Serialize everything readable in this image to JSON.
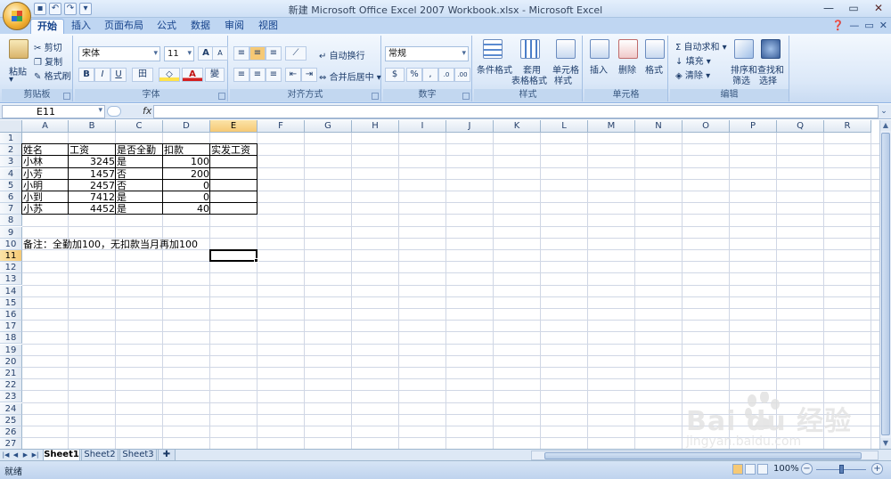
{
  "app": {
    "title": "新建 Microsoft Office Excel 2007 Workbook.xlsx - Microsoft Excel"
  },
  "window_controls": {
    "min": "—",
    "max": "▭",
    "close": "✕"
  },
  "tabs": [
    "开始",
    "插入",
    "页面布局",
    "公式",
    "数据",
    "审阅",
    "视图"
  ],
  "ribbon": {
    "clipboard": {
      "paste": "粘贴",
      "cut": "剪切",
      "copy": "复制",
      "format_painter": "格式刷",
      "label": "剪贴板"
    },
    "font": {
      "font_name": "宋体",
      "font_size": "11",
      "grow": "A",
      "shrink": "A",
      "bold": "B",
      "italic": "I",
      "underline": "U",
      "border": "田",
      "fill": "◇",
      "color": "A",
      "phonetic": "變",
      "label": "字体"
    },
    "alignment": {
      "wrap": "自动换行",
      "merge": "合并后居中",
      "label": "对齐方式"
    },
    "number": {
      "format": "常规",
      "currency": "$",
      "percent": "%",
      "comma": ",",
      "inc": ".0",
      "dec": ".00",
      "label": "数字"
    },
    "styles": {
      "conditional": "条件格式",
      "table_line1": "套用",
      "table_line2": "表格格式",
      "cell_line1": "单元格",
      "cell_line2": "样式",
      "label": "样式"
    },
    "cells": {
      "insert": "插入",
      "delete": "删除",
      "format": "格式",
      "label": "单元格"
    },
    "editing": {
      "autosum": "Σ 自动求和",
      "fill": "填充",
      "clear": "清除",
      "sort_line1": "排序和",
      "sort_line2": "筛选",
      "find_line1": "查找和",
      "find_line2": "选择",
      "label": "编辑"
    }
  },
  "formula_bar": {
    "name_box": "E11",
    "fx": "fx",
    "formula": ""
  },
  "columns": [
    "A",
    "B",
    "C",
    "D",
    "E",
    "F",
    "G",
    "H",
    "I",
    "J",
    "K",
    "L",
    "M",
    "N",
    "O",
    "P",
    "Q",
    "R"
  ],
  "rows": [
    "1",
    "2",
    "3",
    "4",
    "5",
    "6",
    "7",
    "8",
    "9",
    "10",
    "11",
    "12",
    "13",
    "14",
    "15",
    "16",
    "17",
    "18",
    "19",
    "20",
    "21",
    "22",
    "23",
    "24",
    "25",
    "26",
    "27"
  ],
  "selected": {
    "column": "E",
    "row": "11"
  },
  "cells": {
    "A2": "姓名",
    "B2": "工资",
    "C2": "是否全勤",
    "D2": "扣款",
    "E2": "实发工资",
    "A3": "小林",
    "B3": "3245",
    "C3": "是",
    "D3": "100",
    "A4": "小芳",
    "B4": "1457",
    "C4": "否",
    "D4": "200",
    "A5": "小明",
    "B5": "2457",
    "C5": "否",
    "D5": "0",
    "A6": "小到",
    "B6": "7412",
    "C6": "是",
    "D6": "0",
    "A7": "小苏",
    "B7": "4452",
    "C7": "是",
    "D7": "40",
    "A10": "备注：全勤加100，无扣款当月再加100"
  },
  "sheets": [
    "Sheet1",
    "Sheet2",
    "Sheet3"
  ],
  "active_sheet": "Sheet1",
  "status": {
    "ready": "就绪",
    "zoom": "100%"
  },
  "watermark": {
    "text": "Bai du 经验",
    "url": "jingyan.baidu.com"
  },
  "colors": {
    "ribbon": "#dbe8f8",
    "header_selected": "#f6c975",
    "tab_active": "#f6f9fe"
  }
}
